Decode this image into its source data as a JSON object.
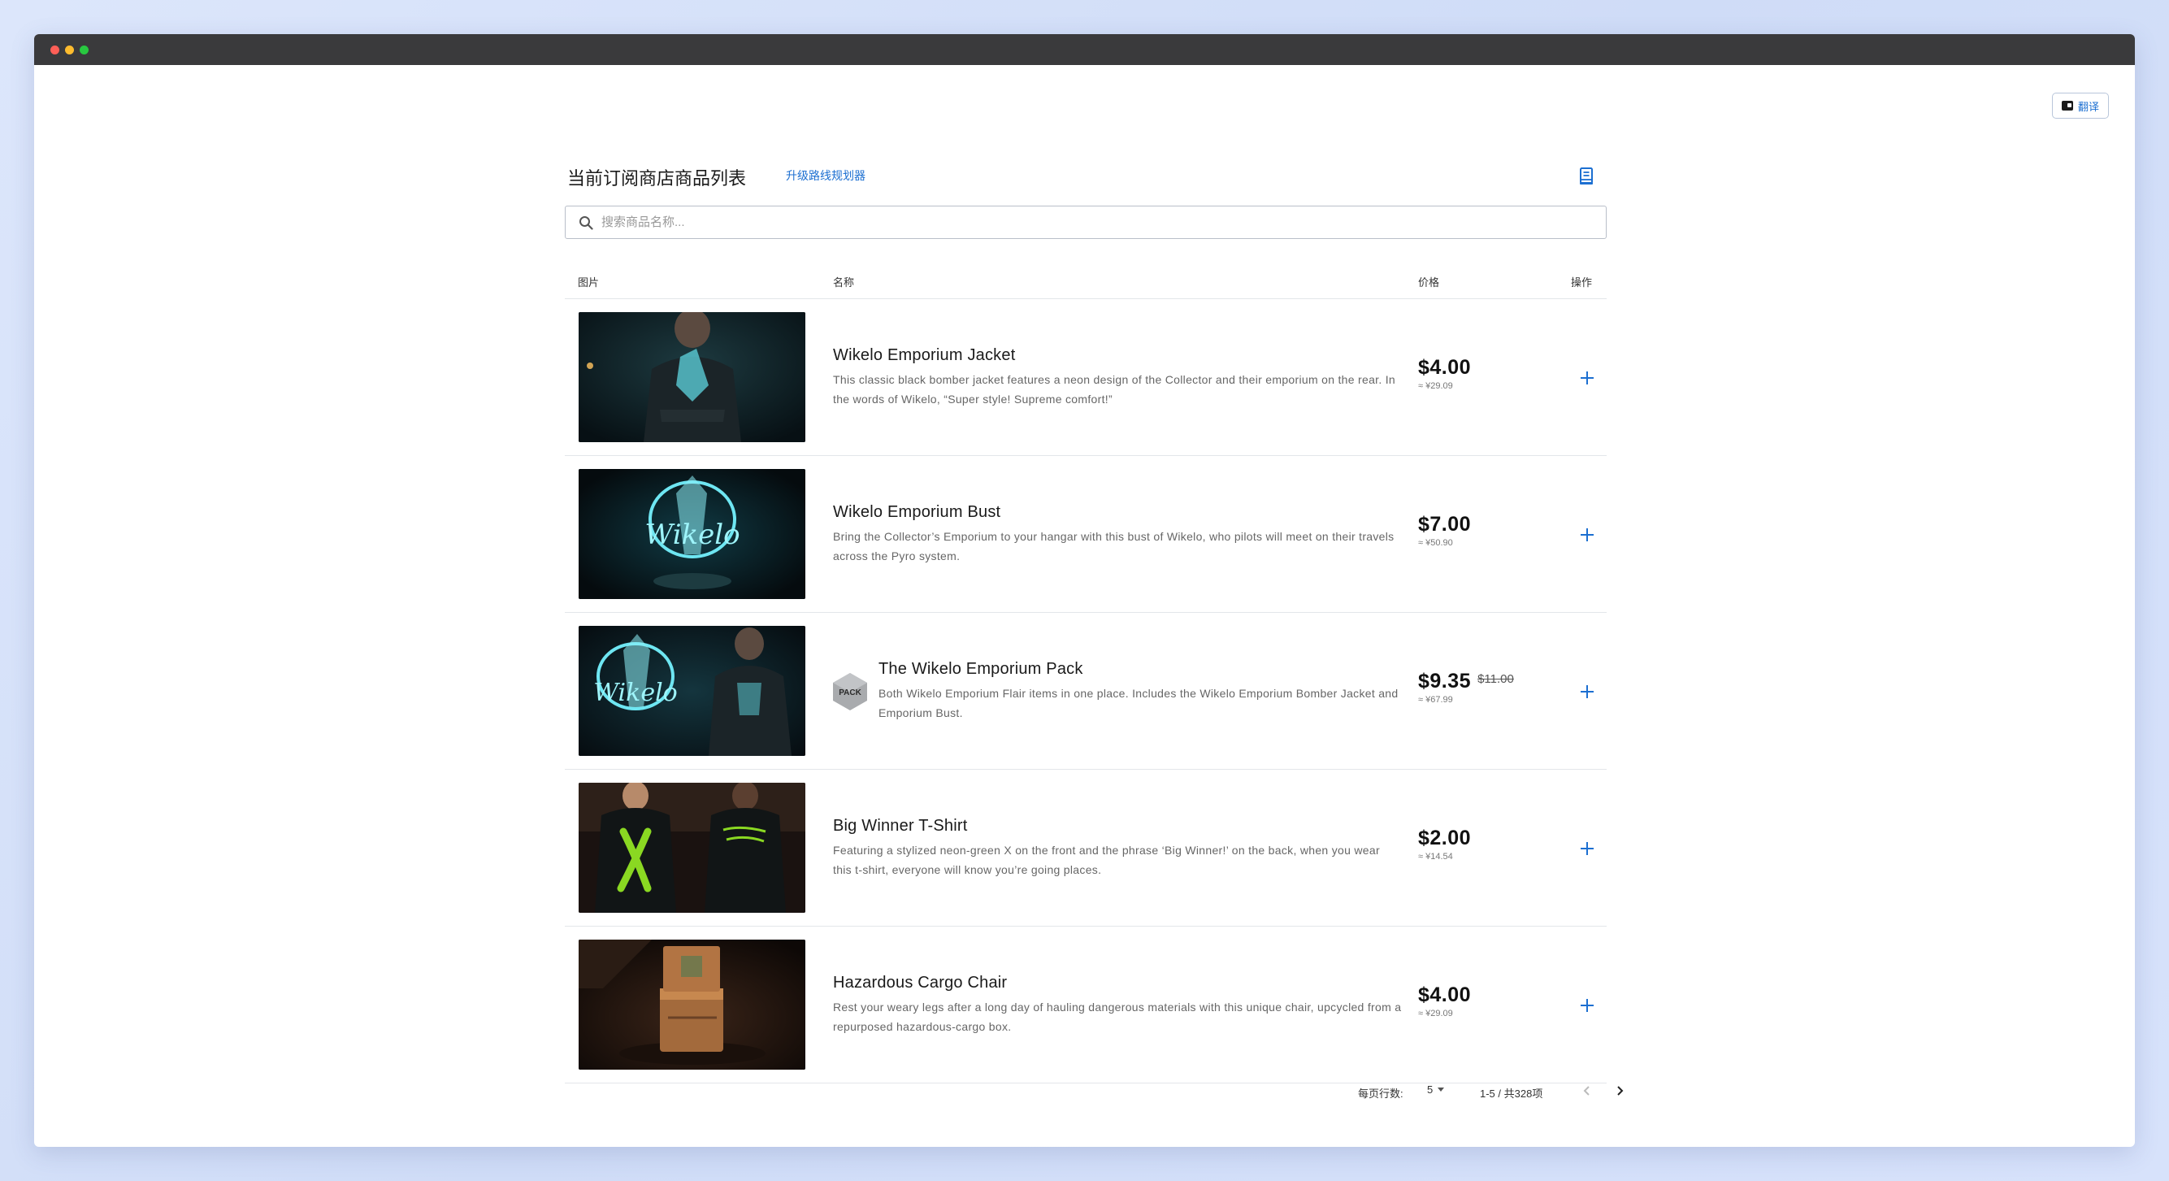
{
  "translate": {
    "label": "翻译"
  },
  "header": {
    "title": "当前订阅商店商品列表",
    "upgrade_link": "升级路线规划器",
    "doc_icon": "document-icon"
  },
  "search": {
    "placeholder": "搜索商品名称..."
  },
  "table": {
    "columns": {
      "image": "图片",
      "name": "名称",
      "price": "价格",
      "action": "操作"
    },
    "rows": [
      {
        "name": "Wikelo Emporium Jacket",
        "description": "This classic black bomber jacket features a neon design of the Collector and their emporium on the rear. In the words of Wikelo, “Super style! Supreme comfort!”",
        "price": "$4.00",
        "cny": "≈ ¥29.09",
        "badge": ""
      },
      {
        "name": "Wikelo Emporium Bust",
        "description": "Bring the Collector’s Emporium to your hangar with this bust of Wikelo, who pilots will meet on their travels across the Pyro system.",
        "price": "$7.00",
        "cny": "≈ ¥50.90",
        "badge": ""
      },
      {
        "name": "The Wikelo Emporium Pack",
        "description": "Both Wikelo Emporium Flair items in one place. Includes the Wikelo Emporium Bomber Jacket and Emporium Bust.",
        "price": "$9.35",
        "old_price": "$11.00",
        "cny": "≈ ¥67.99",
        "badge": "PACK"
      },
      {
        "name": "Big Winner T-Shirt",
        "description": "Featuring a stylized neon-green X on the front and the phrase ‘Big Winner!’ on the back, when you wear this t-shirt, everyone will know you’re going places.",
        "price": "$2.00",
        "cny": "≈ ¥14.54",
        "badge": ""
      },
      {
        "name": "Hazardous Cargo Chair",
        "description": "Rest your weary legs after a long day of hauling dangerous materials with this unique chair, upcycled from a repurposed hazardous-cargo box.",
        "price": "$4.00",
        "cny": "≈ ¥29.09",
        "badge": ""
      }
    ]
  },
  "pagination": {
    "rows_per_page_label": "每页行数:",
    "rows_per_page": "5",
    "range": "1-5 / 共328项"
  },
  "colors": {
    "accent": "#1c6fd1",
    "titlebar": "#3a3a3c",
    "background": "#d5e0f8"
  }
}
